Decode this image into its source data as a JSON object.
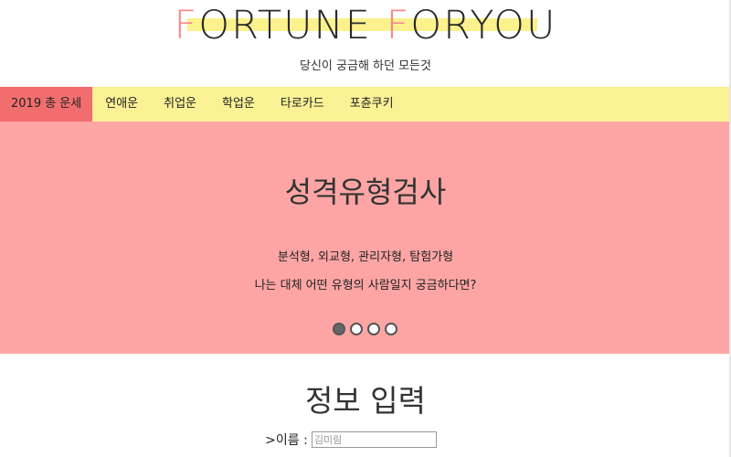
{
  "header": {
    "logo": {
      "letter1": "F",
      "part1": "ORTUNE ",
      "letter2": "F",
      "part2": "ORYOU"
    },
    "subtitle": "당신이 궁금해 하던 모든것"
  },
  "nav": {
    "items": [
      {
        "label": "2019 총 운세",
        "active": true
      },
      {
        "label": "연애운"
      },
      {
        "label": "취업운"
      },
      {
        "label": "학업운"
      },
      {
        "label": "타로카드"
      },
      {
        "label": "포츈쿠키"
      }
    ]
  },
  "hero": {
    "title": "성격유형검사",
    "line1": "분석형, 외교형, 관리자형, 탐험가형",
    "line2": "나는 대체 어떤 유형의 사람일지 궁금하다면?",
    "slides_total": 4,
    "active_slide": 1
  },
  "info": {
    "title": "정보 입력",
    "name_label": ">이름 :",
    "name_placeholder": "김미림"
  },
  "colors": {
    "nav_bg": "#fbf195",
    "nav_active": "#f26e6e",
    "hero_bg": "#fda5a5",
    "logo_highlight": "#f28b8b",
    "logo_bar": "#fbf18d"
  }
}
